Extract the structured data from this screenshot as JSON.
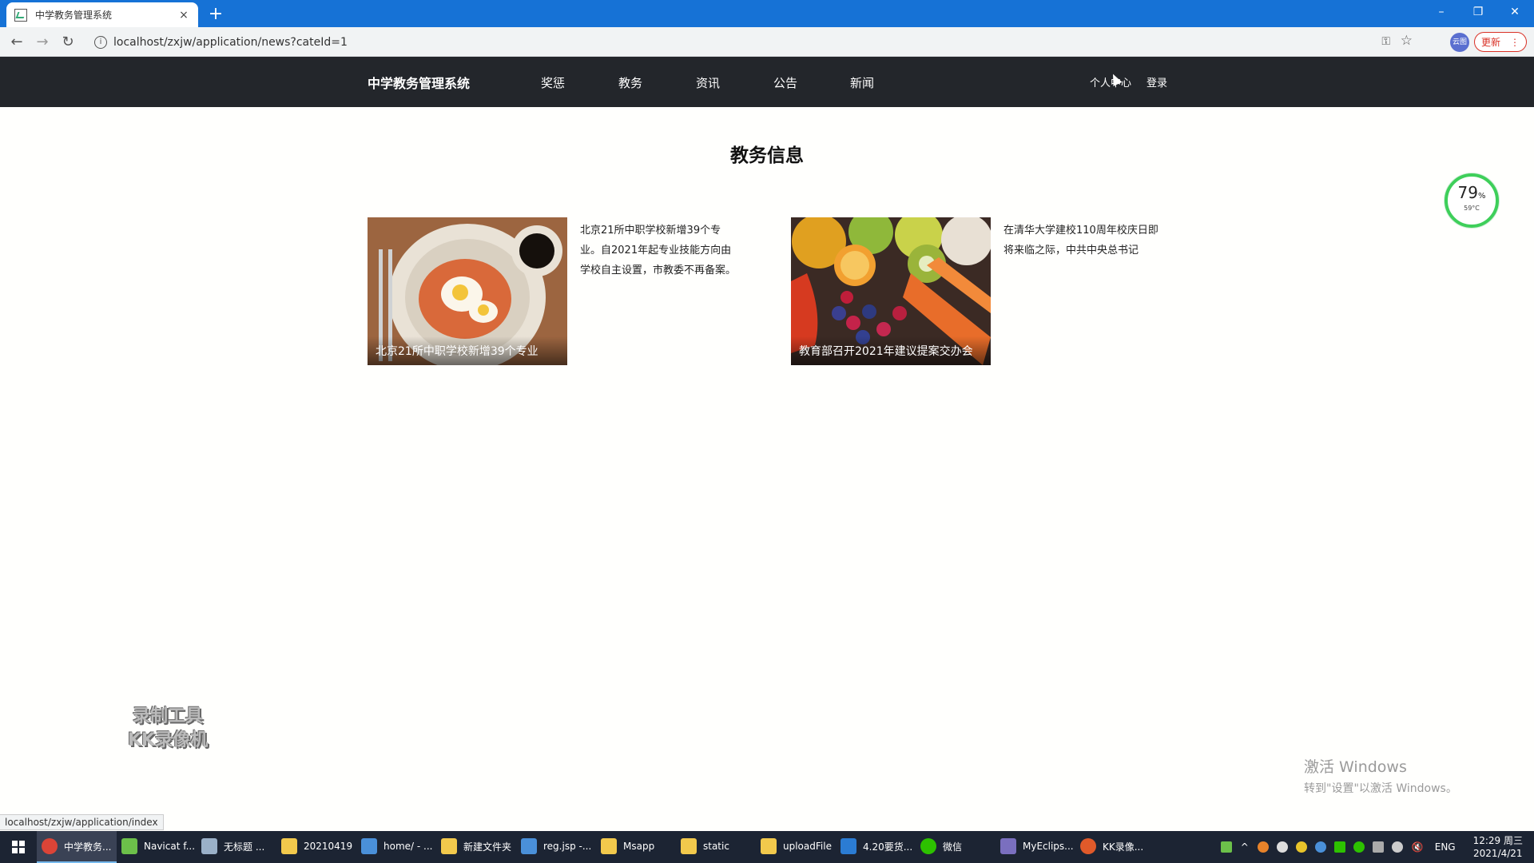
{
  "browser": {
    "tab_title": "中学教务管理系统",
    "tab_close": "×",
    "new_tab": "+",
    "window_controls": [
      "–",
      "❐",
      "✕"
    ],
    "url": "localhost/zxjw/application/news?cateId=1",
    "profile_label": "云图",
    "update_label": "更新",
    "status_url": "localhost/zxjw/application/index"
  },
  "site": {
    "brand": "中学教务管理系统",
    "nav": [
      "奖惩",
      "教务",
      "资讯",
      "公告",
      "新闻"
    ],
    "personal": "个人中心",
    "login": "登录"
  },
  "page": {
    "title": "教务信息",
    "cards": [
      {
        "caption": "北京21所中职学校新增39个专业",
        "summary": "北京21所中职学校新增39个专业。自2021年起专业技能方向由学校自主设置，市教委不再备案。"
      },
      {
        "caption": "教育部召开2021年建议提案交办会",
        "summary": "在清华大学建校110周年校庆日即将来临之际，中共中央总书记"
      }
    ]
  },
  "overlays": {
    "gauge_percent": "79",
    "gauge_unit": "%",
    "gauge_temp": "59°C",
    "recorder_line1": "录制工具",
    "recorder_line2": "KK录像机",
    "activate_line1": "激活 Windows",
    "activate_line2": "转到\"设置\"以激活 Windows。"
  },
  "taskbar": {
    "items": [
      "中学教务...",
      "Navicat f...",
      "无标题 ...",
      "20210419",
      "home/ - ...",
      "新建文件夹",
      "reg.jsp -...",
      "Msapp",
      "static",
      "uploadFile",
      "4.20要货...",
      "微信",
      "MyEclips...",
      "KK录像..."
    ],
    "lang": "ENG",
    "time": "12:29 周三",
    "date": "2021/4/21"
  }
}
